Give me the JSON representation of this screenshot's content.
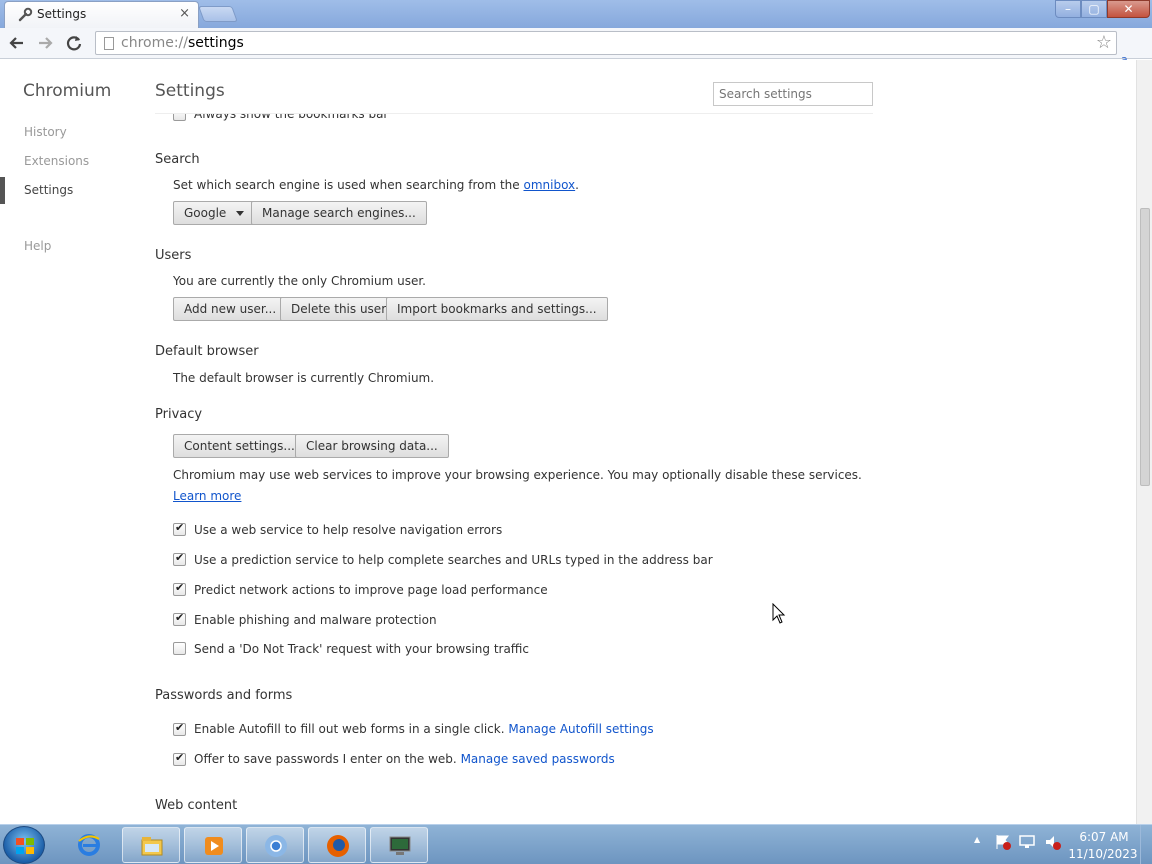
{
  "tab": {
    "title": "Settings",
    "close": "×"
  },
  "window": {
    "minimize": "–",
    "maximize": "▢",
    "close": "✕"
  },
  "toolbar": {
    "url_scheme": "chrome://",
    "url_path": "settings",
    "ext_badge": "a"
  },
  "sidebar": {
    "brand": "Chromium",
    "items": [
      "History",
      "Extensions",
      "Settings",
      "Help"
    ]
  },
  "page": {
    "title": "Settings",
    "search_placeholder": "Search settings",
    "partial_item": "Always show the bookmarks bar"
  },
  "search": {
    "heading": "Search",
    "desc_prefix": "Set which search engine is used when searching from the ",
    "desc_link": "omnibox",
    "desc_suffix": ".",
    "engine": "Google",
    "manage": "Manage search engines..."
  },
  "users": {
    "heading": "Users",
    "desc": "You are currently the only Chromium user.",
    "add": "Add new user...",
    "delete": "Delete this user",
    "import": "Import bookmarks and settings..."
  },
  "default_browser": {
    "heading": "Default browser",
    "desc": "The default browser is currently Chromium."
  },
  "privacy": {
    "heading": "Privacy",
    "content_settings": "Content settings...",
    "clear_data": "Clear browsing data...",
    "desc": "Chromium may use web services to improve your browsing experience. You may optionally disable these services.",
    "learn_more": "Learn more",
    "options": [
      {
        "label": "Use a web service to help resolve navigation errors",
        "checked": true
      },
      {
        "label": "Use a prediction service to help complete searches and URLs typed in the address bar",
        "checked": true
      },
      {
        "label": "Predict network actions to improve page load performance",
        "checked": true
      },
      {
        "label": "Enable phishing and malware protection",
        "checked": true
      },
      {
        "label": "Send a 'Do Not Track' request with your browsing traffic",
        "checked": false
      }
    ]
  },
  "passwords": {
    "heading": "Passwords and forms",
    "autofill_label": "Enable Autofill to fill out web forms in a single click.",
    "autofill_link": "Manage Autofill settings",
    "save_label": "Offer to save passwords I enter on the web.",
    "save_link": "Manage saved passwords"
  },
  "web_content": {
    "heading": "Web content"
  },
  "taskbar": {
    "time": "6:07 AM",
    "date": "11/10/2023",
    "tray_arrow": "▲"
  }
}
